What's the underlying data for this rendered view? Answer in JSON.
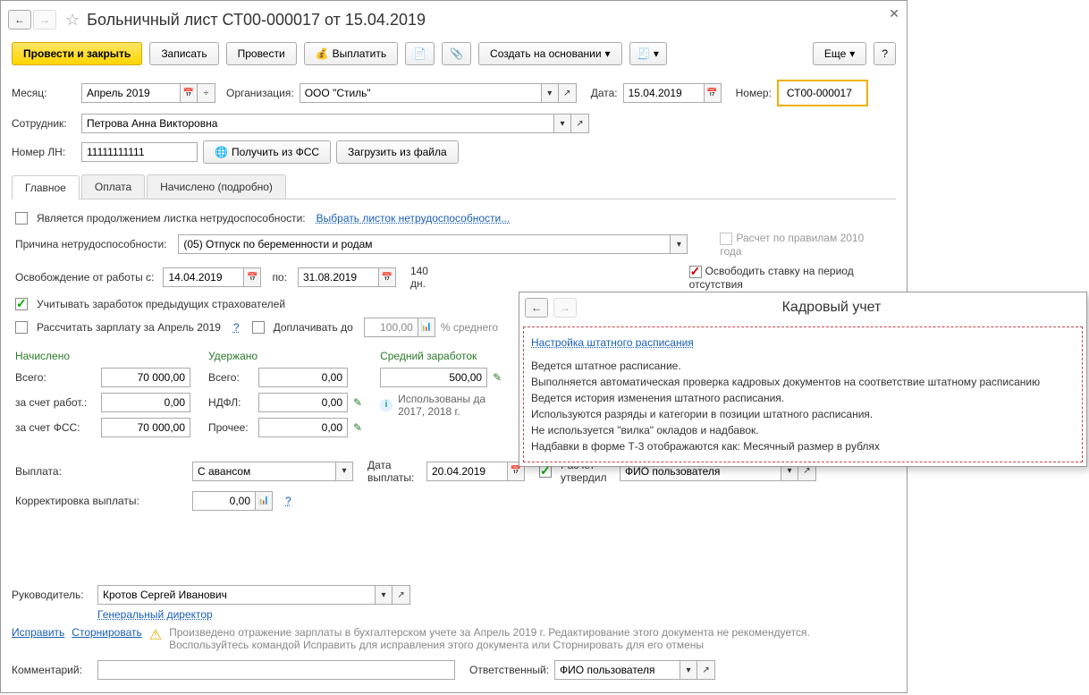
{
  "title": "Больничный лист СТ00-000017 от 15.04.2019",
  "toolbar": {
    "post_close": "Провести и закрыть",
    "write": "Записать",
    "post": "Провести",
    "pay": "Выплатить",
    "create_based": "Создать на основании",
    "more": "Еще",
    "help": "?"
  },
  "fields": {
    "month_lbl": "Месяц:",
    "month": "Апрель 2019",
    "org_lbl": "Организация:",
    "org": "ООО \"Стиль\"",
    "date_lbl": "Дата:",
    "date": "15.04.2019",
    "number_lbl": "Номер:",
    "number": "СТ00-000017",
    "emp_lbl": "Сотрудник:",
    "emp": "Петрова Анна Викторовна",
    "ln_lbl": "Номер ЛН:",
    "ln": "11111111111",
    "get_fss": "Получить из ФСС",
    "load_file": "Загрузить из файла"
  },
  "tabs": {
    "main": "Главное",
    "pay": "Оплата",
    "calc": "Начислено (подробно)"
  },
  "main": {
    "is_cont": "Является продолжением листка нетрудоспособности:",
    "select_sheet": "Выбрать листок нетрудоспособности...",
    "reason_lbl": "Причина нетрудоспособности:",
    "reason": "(05) Отпуск по беременности и родам",
    "calc2010": "Расчет по правилам 2010 года",
    "free_rate": "Освободить ставку на период отсутствия",
    "free_from_lbl": "Освобождение от работы с:",
    "from_date": "14.04.2019",
    "to_lbl": "по:",
    "to_date": "31.08.2019",
    "days": "140 дн.",
    "prev_emp": "Учитывать заработок предыдущих страхователей",
    "calc_salary": "Рассчитать зарплату за Апрель 2019",
    "pay_extra": "Доплачивать до",
    "pay_extra_val": "100,00",
    "percent_avg": "% среднего",
    "accrued_h": "Начислено",
    "withheld_h": "Удержано",
    "avg_h": "Средний заработок",
    "total": "Всего:",
    "accrued_total": "70 000,00",
    "withheld_total": "0,00",
    "avg_val": "500,00",
    "by_emp": "за счет работ.:",
    "by_emp_val": "0,00",
    "ndfl": "НДФЛ:",
    "ndfl_val": "0,00",
    "used_data": "Использованы да",
    "used_years": "2017,  2018 г.",
    "by_fss": "за счет ФСС:",
    "by_fss_val": "70 000,00",
    "other": "Прочее:",
    "other_val": "0,00",
    "payment_lbl": "Выплата:",
    "payment": "С авансом",
    "pay_date_lbl": "Дата выплаты:",
    "pay_date": "20.04.2019",
    "approved": "Расчет утвердил",
    "approver": "ФИО пользователя",
    "corr_lbl": "Корректировка выплаты:",
    "corr_val": "0,00"
  },
  "popup": {
    "title": "Кадровый учет",
    "link": "Настройка штатного расписания",
    "l1": "Ведется штатное расписание.",
    "l2": "Выполняется автоматическая проверка кадровых документов на соответствие штатному расписанию",
    "l3": "Ведется история изменения штатного расписания.",
    "l4": "Используются разряды и категории в позиции штатного расписания.",
    "l5": "Не используется \"вилка\" окладов и надбавок.",
    "l6": "Надбавки в форме Т-3 отображаются как: Месячный размер в рублях"
  },
  "footer": {
    "mgr_lbl": "Руководитель:",
    "mgr": "Кротов Сергей Иванович",
    "mgr_pos": "Генеральный директор",
    "fix": "Исправить",
    "storno": "Сторнировать",
    "warn1": "Произведено отражение зарплаты в бухгалтерском учете за Апрель 2019 г. Редактирование этого документа не рекомендуется.",
    "warn2": "Воспользуйтесь командой Исправить для исправления этого документа или Сторнировать для его отмены",
    "comment_lbl": "Комментарий:",
    "resp_lbl": "Ответственный:",
    "resp": "ФИО пользователя"
  }
}
